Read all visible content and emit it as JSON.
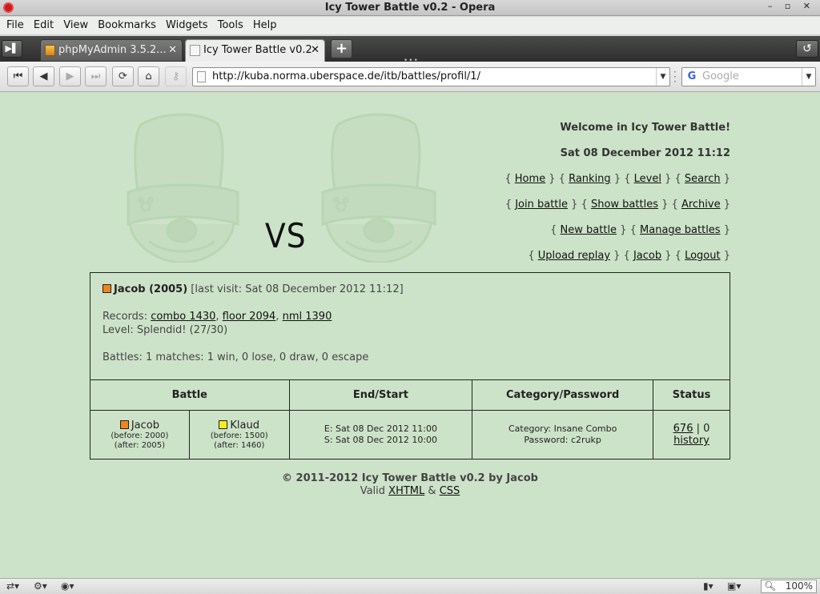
{
  "window": {
    "title": "Icy Tower Battle v0.2 - Opera",
    "controls": "– ▫ ✕"
  },
  "menu": [
    "File",
    "Edit",
    "View",
    "Bookmarks",
    "Widgets",
    "Tools",
    "Help"
  ],
  "tabs": [
    {
      "label": "phpMyAdmin 3.5.2...",
      "active": false
    },
    {
      "label": "Icy Tower Battle v0.2",
      "active": true
    }
  ],
  "toolbar": {
    "url": "http://kuba.norma.uberspace.de/itb/battles/profil/1/",
    "search_placeholder": "Google"
  },
  "header": {
    "welcome": "Welcome in Icy Tower Battle!",
    "datetime": "Sat 08 December 2012 11:12",
    "vs": "VS",
    "nav": [
      [
        "Home",
        "Ranking",
        "Level",
        "Search"
      ],
      [
        "Join battle",
        "Show battles",
        "Archive"
      ],
      [
        "New battle",
        "Manage battles"
      ],
      [
        "Upload replay",
        "Jacob",
        "Logout"
      ]
    ]
  },
  "profile": {
    "name": "Jacob (2005)",
    "last_visit": "[last visit: Sat 08 December 2012 11:12]",
    "records_label": "Records:",
    "records": [
      "combo 1430",
      "floor 2094",
      "nml 1390"
    ],
    "level": "Level: Splendid! (27/30)",
    "battles": "Battles: 1 matches: 1 win, 0 lose, 0 draw, 0 escape",
    "player_color": "#f0851e"
  },
  "table": {
    "headers": [
      "Battle",
      "End/Start",
      "Category/Password",
      "Status"
    ],
    "row": {
      "player1": {
        "name": "Jacob",
        "before": "(before: 2000)",
        "after": "(after: 2005)",
        "color": "#f0851e"
      },
      "player2": {
        "name": "Klaud",
        "before": "(before: 1500)",
        "after": "(after: 1460)",
        "color": "#f4ef1a"
      },
      "end": "E: Sat 08 Dec 2012 11:00",
      "start": "S: Sat 08 Dec 2012 10:00",
      "category": "Category: Insane Combo",
      "password": "Password: c2rukp",
      "status_score": "676",
      "status_sep": " | 0",
      "status_history": "history"
    }
  },
  "footer": {
    "copyright": "© 2011-2012 Icy Tower Battle v0.2 by Jacob",
    "valid_prefix": "Valid",
    "xhtml": "XHTML",
    "amp": "&",
    "css": "CSS"
  },
  "statusbar": {
    "zoom": "100%"
  }
}
